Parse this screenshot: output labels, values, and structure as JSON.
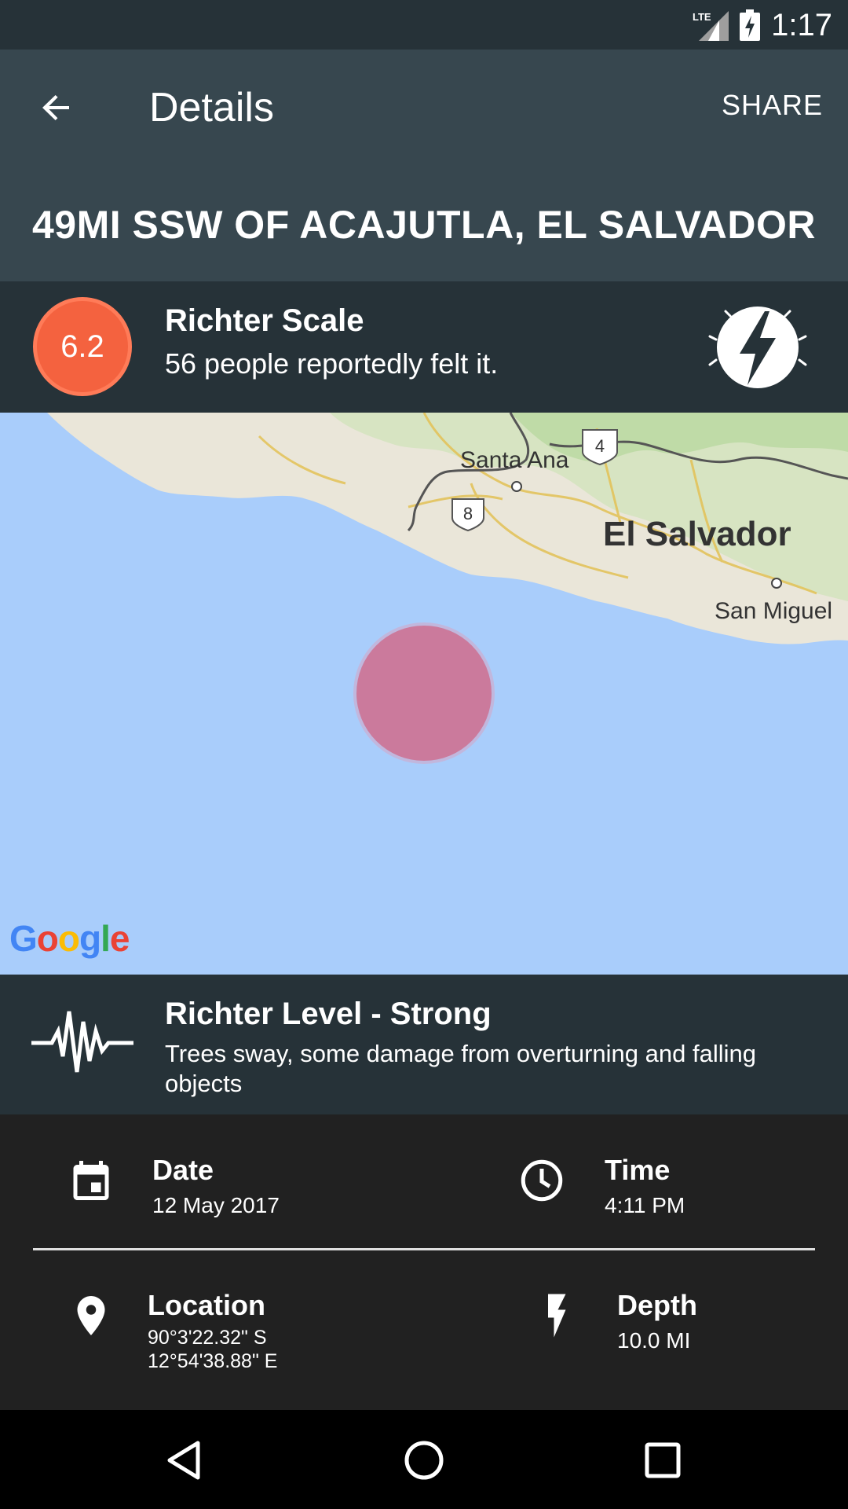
{
  "status_bar": {
    "network": "LTE",
    "time": "1:17",
    "icons": [
      "lte-signal-icon",
      "battery-charging-icon"
    ]
  },
  "toolbar": {
    "back_icon": "arrow-back-icon",
    "title": "Details",
    "share_label": "SHARE"
  },
  "header": {
    "place": "49MI SSW OF ACAJUTLA, EL SALVADOR"
  },
  "magnitude": {
    "value": "6.2",
    "title": "Richter Scale",
    "felt": "56 people reportedly felt it.",
    "badge_color": "#f4623f",
    "alert_icon": "alert-lightning-icon"
  },
  "map": {
    "labels": {
      "city_1": "Santa Ana",
      "country": "El Salvador",
      "city_2": "San Miguel",
      "route_1": "4",
      "route_2": "8"
    },
    "attribution": "Google",
    "marker_color": "#cc7090",
    "water_color": "#a9cdfb"
  },
  "level": {
    "icon": "seismic-wave-icon",
    "title": "Richter Level - Strong",
    "description": "Trees sway, some damage from overturning and falling objects"
  },
  "details": {
    "date": {
      "icon": "calendar-icon",
      "label": "Date",
      "value": "12 May 2017"
    },
    "time": {
      "icon": "clock-icon",
      "label": "Time",
      "value": "4:11 PM"
    },
    "location": {
      "icon": "location-pin-icon",
      "label": "Location",
      "lat": "90°3'22.32\" S",
      "lon": "12°54'38.88\" E"
    },
    "depth": {
      "icon": "lightning-icon",
      "label": "Depth",
      "value": "10.0 MI"
    }
  },
  "nav_bar": {
    "back": "nav-back-icon",
    "home": "nav-home-icon",
    "recents": "nav-recents-icon"
  }
}
